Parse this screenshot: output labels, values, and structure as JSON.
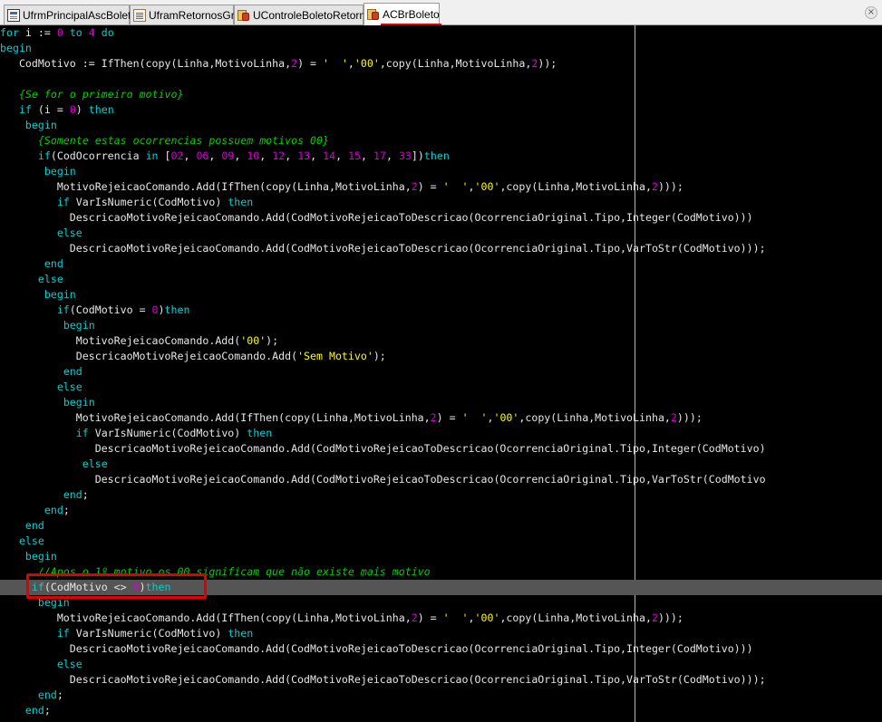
{
  "tabs": [
    {
      "label": "UfrmPrincipalAscBoleto",
      "icon": "form-icon"
    },
    {
      "label": "UframRetornosGrid",
      "icon": "unit-icon"
    },
    {
      "label": "UControleBoletoRetorno",
      "icon": "pascal-unit-icon"
    },
    {
      "label": "ACBrBoleto",
      "icon": "pascal-unit-icon",
      "active": true
    }
  ],
  "close_symbol": "×",
  "colors": {
    "background": "#000000",
    "keyword": "#00d0d0",
    "number": "#d700d7",
    "string": "#ffff00",
    "comment": "#00d000",
    "identifier": "#e6e6e6",
    "current_line": "#555555",
    "annotation": "#e00000"
  },
  "code_lines": [
    [
      [
        "kw",
        "for"
      ],
      [
        "id",
        " i := "
      ],
      [
        "num",
        "0"
      ],
      [
        "id",
        " "
      ],
      [
        "kw",
        "to"
      ],
      [
        "id",
        " "
      ],
      [
        "num",
        "4"
      ],
      [
        "id",
        " "
      ],
      [
        "kw",
        "do"
      ]
    ],
    [
      [
        "kw",
        "begin"
      ]
    ],
    [
      [
        "id",
        "   CodMotivo := IfThen(copy(Linha,MotivoLinha,"
      ],
      [
        "num",
        "2"
      ],
      [
        "id",
        ") = "
      ],
      [
        "str",
        "'  '"
      ],
      [
        "id",
        ","
      ],
      [
        "str",
        "'00'"
      ],
      [
        "id",
        ",copy(Linha,MotivoLinha,"
      ],
      [
        "num",
        "2"
      ],
      [
        "id",
        "));"
      ]
    ],
    [],
    [
      [
        "id",
        "   "
      ],
      [
        "cmt",
        "{Se for o primeiro motivo}"
      ]
    ],
    [
      [
        "id",
        "   "
      ],
      [
        "kw",
        "if"
      ],
      [
        "id",
        " (i = "
      ],
      [
        "num",
        "0"
      ],
      [
        "id",
        ") "
      ],
      [
        "kw",
        "then"
      ]
    ],
    [
      [
        "id",
        "    "
      ],
      [
        "kw",
        "begin"
      ]
    ],
    [
      [
        "id",
        "      "
      ],
      [
        "cmt",
        "{Somente estas ocorrencias possuem motivos 00}"
      ]
    ],
    [
      [
        "id",
        "      "
      ],
      [
        "kw",
        "if"
      ],
      [
        "id",
        "(CodOcorrencia "
      ],
      [
        "kw",
        "in"
      ],
      [
        "id",
        " ["
      ],
      [
        "num",
        "02"
      ],
      [
        "id",
        ", "
      ],
      [
        "num",
        "06"
      ],
      [
        "id",
        ", "
      ],
      [
        "num",
        "09"
      ],
      [
        "id",
        ", "
      ],
      [
        "num",
        "10"
      ],
      [
        "id",
        ", "
      ],
      [
        "num",
        "12"
      ],
      [
        "id",
        ", "
      ],
      [
        "num",
        "13"
      ],
      [
        "id",
        ", "
      ],
      [
        "num",
        "14"
      ],
      [
        "id",
        ", "
      ],
      [
        "num",
        "15"
      ],
      [
        "id",
        ", "
      ],
      [
        "num",
        "17"
      ],
      [
        "id",
        ", "
      ],
      [
        "num",
        "33"
      ],
      [
        "id",
        "])"
      ],
      [
        "kw",
        "then"
      ]
    ],
    [
      [
        "id",
        "       "
      ],
      [
        "kw",
        "begin"
      ]
    ],
    [
      [
        "id",
        "         MotivoRejeicaoComando.Add(IfThen(copy(Linha,MotivoLinha,"
      ],
      [
        "num",
        "2"
      ],
      [
        "id",
        ") = "
      ],
      [
        "str",
        "'  '"
      ],
      [
        "id",
        ","
      ],
      [
        "str",
        "'00'"
      ],
      [
        "id",
        ",copy(Linha,MotivoLinha,"
      ],
      [
        "num",
        "2"
      ],
      [
        "id",
        ")));"
      ]
    ],
    [
      [
        "id",
        "         "
      ],
      [
        "kw",
        "if"
      ],
      [
        "id",
        " VarIsNumeric(CodMotivo) "
      ],
      [
        "kw",
        "then"
      ]
    ],
    [
      [
        "id",
        "           DescricaoMotivoRejeicaoComando.Add(CodMotivoRejeicaoToDescricao(OcorrenciaOriginal.Tipo,Integer(CodMotivo)))"
      ]
    ],
    [
      [
        "id",
        "         "
      ],
      [
        "kw",
        "else"
      ]
    ],
    [
      [
        "id",
        "           DescricaoMotivoRejeicaoComando.Add(CodMotivoRejeicaoToDescricao(OcorrenciaOriginal.Tipo,VarToStr(CodMotivo)));"
      ]
    ],
    [
      [
        "id",
        "       "
      ],
      [
        "kw",
        "end"
      ]
    ],
    [
      [
        "id",
        "      "
      ],
      [
        "kw",
        "else"
      ]
    ],
    [
      [
        "id",
        "       "
      ],
      [
        "kw",
        "begin"
      ]
    ],
    [
      [
        "id",
        "         "
      ],
      [
        "kw",
        "if"
      ],
      [
        "id",
        "(CodMotivo = "
      ],
      [
        "num",
        "0"
      ],
      [
        "id",
        ")"
      ],
      [
        "kw",
        "then"
      ]
    ],
    [
      [
        "id",
        "          "
      ],
      [
        "kw",
        "begin"
      ]
    ],
    [
      [
        "id",
        "            MotivoRejeicaoComando.Add("
      ],
      [
        "str",
        "'00'"
      ],
      [
        "id",
        ");"
      ]
    ],
    [
      [
        "id",
        "            DescricaoMotivoRejeicaoComando.Add("
      ],
      [
        "str",
        "'Sem Motivo'"
      ],
      [
        "id",
        ");"
      ]
    ],
    [
      [
        "id",
        "          "
      ],
      [
        "kw",
        "end"
      ]
    ],
    [
      [
        "id",
        "         "
      ],
      [
        "kw",
        "else"
      ]
    ],
    [
      [
        "id",
        "          "
      ],
      [
        "kw",
        "begin"
      ]
    ],
    [
      [
        "id",
        "            MotivoRejeicaoComando.Add(IfThen(copy(Linha,MotivoLinha,"
      ],
      [
        "num",
        "2"
      ],
      [
        "id",
        ") = "
      ],
      [
        "str",
        "'  '"
      ],
      [
        "id",
        ","
      ],
      [
        "str",
        "'00'"
      ],
      [
        "id",
        ",copy(Linha,MotivoLinha,"
      ],
      [
        "num",
        "2"
      ],
      [
        "id",
        ")));"
      ]
    ],
    [
      [
        "id",
        "            "
      ],
      [
        "kw",
        "if"
      ],
      [
        "id",
        " VarIsNumeric(CodMotivo) "
      ],
      [
        "kw",
        "then"
      ]
    ],
    [
      [
        "id",
        "               DescricaoMotivoRejeicaoComando.Add(CodMotivoRejeicaoToDescricao(OcorrenciaOriginal.Tipo,Integer(CodMotivo)"
      ]
    ],
    [
      [
        "id",
        "             "
      ],
      [
        "kw",
        "else"
      ]
    ],
    [
      [
        "id",
        "               DescricaoMotivoRejeicaoComando.Add(CodMotivoRejeicaoToDescricao(OcorrenciaOriginal.Tipo,VarToStr(CodMotivo"
      ]
    ],
    [
      [
        "id",
        "          "
      ],
      [
        "kw",
        "end"
      ],
      [
        "id",
        ";"
      ]
    ],
    [
      [
        "id",
        "       "
      ],
      [
        "kw",
        "end"
      ],
      [
        "id",
        ";"
      ]
    ],
    [
      [
        "id",
        "    "
      ],
      [
        "kw",
        "end"
      ]
    ],
    [
      [
        "id",
        "   "
      ],
      [
        "kw",
        "else"
      ]
    ],
    [
      [
        "id",
        "    "
      ],
      [
        "kw",
        "begin"
      ]
    ],
    [
      [
        "id",
        "      "
      ],
      [
        "cmt",
        "//Apos o 1º motivo os 00 significam que não existe mais motivo"
      ]
    ],
    [
      [
        "id",
        "     "
      ],
      [
        "kw",
        "if"
      ],
      [
        "id",
        "(CodMotivo <> "
      ],
      [
        "num",
        "0"
      ],
      [
        "id",
        ")"
      ],
      [
        "kw",
        "then"
      ]
    ],
    [
      [
        "id",
        "      "
      ],
      [
        "kw",
        "begin"
      ]
    ],
    [
      [
        "id",
        "         MotivoRejeicaoComando.Add(IfThen(copy(Linha,MotivoLinha,"
      ],
      [
        "num",
        "2"
      ],
      [
        "id",
        ") = "
      ],
      [
        "str",
        "'  '"
      ],
      [
        "id",
        ","
      ],
      [
        "str",
        "'00'"
      ],
      [
        "id",
        ",copy(Linha,MotivoLinha,"
      ],
      [
        "num",
        "2"
      ],
      [
        "id",
        ")));"
      ]
    ],
    [
      [
        "id",
        "         "
      ],
      [
        "kw",
        "if"
      ],
      [
        "id",
        " VarIsNumeric(CodMotivo) "
      ],
      [
        "kw",
        "then"
      ]
    ],
    [
      [
        "id",
        "           DescricaoMotivoRejeicaoComando.Add(CodMotivoRejeicaoToDescricao(OcorrenciaOriginal.Tipo,Integer(CodMotivo)))"
      ]
    ],
    [
      [
        "id",
        "         "
      ],
      [
        "kw",
        "else"
      ]
    ],
    [
      [
        "id",
        "           DescricaoMotivoRejeicaoComando.Add(CodMotivoRejeicaoToDescricao(OcorrenciaOriginal.Tipo,VarToStr(CodMotivo)));"
      ]
    ],
    [
      [
        "id",
        "      "
      ],
      [
        "kw",
        "end"
      ],
      [
        "id",
        ";"
      ]
    ],
    [
      [
        "id",
        "    "
      ],
      [
        "kw",
        "end"
      ],
      [
        "id",
        ";"
      ]
    ]
  ],
  "current_line_index": 36,
  "highlighted_line_index": 36
}
